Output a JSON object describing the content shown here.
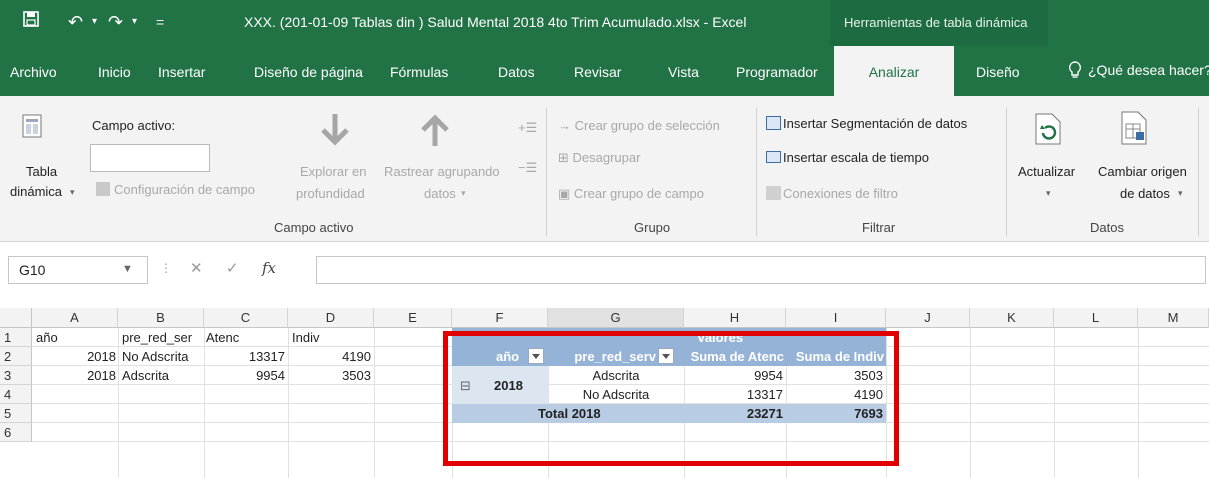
{
  "titlebar": {
    "save_icon": "save-icon",
    "title": "XXX. (201-01-09 Tablas din ) Salud Mental 2018 4to Trim Acumulado.xlsx  -  Excel",
    "context_tools": "Herramientas de tabla dinámica",
    "accent": "#217346"
  },
  "tabs": {
    "archivo": "Archivo",
    "inicio": "Inicio",
    "insertar": "Insertar",
    "diseno_pagina": "Diseño de página",
    "formulas": "Fórmulas",
    "datos": "Datos",
    "revisar": "Revisar",
    "vista": "Vista",
    "programador": "Programador",
    "analizar": "Analizar",
    "diseno": "Diseño",
    "help": "¿Qué desea hacer?"
  },
  "ribbon": {
    "tabla_1": "Tabla",
    "tabla_2": "dinámica",
    "campo_activo_label": "Campo activo:",
    "configuracion_campo": "Configuración de campo",
    "explorar_1": "Explorar en",
    "explorar_2": "profundidad",
    "rastrear_1": "Rastrear agrupando",
    "rastrear_2": "datos",
    "group_campo_activo": "Campo activo",
    "crear_grupo_seleccion": "Crear grupo de selección",
    "desagrupar": "Desagrupar",
    "crear_grupo_campo": "Crear grupo de campo",
    "group_grupo": "Grupo",
    "insertar_segmentacion": "Insertar Segmentación de datos",
    "insertar_escala": "Insertar escala de tiempo",
    "conexiones_filtro": "Conexiones de filtro",
    "group_filtrar": "Filtrar",
    "actualizar": "Actualizar",
    "cambiar_origen_1": "Cambiar origen",
    "cambiar_origen_2": "de datos",
    "group_datos": "Datos"
  },
  "formula_bar": {
    "name_box": "G10",
    "fx": "fx",
    "formula_value": ""
  },
  "columns": [
    "A",
    "B",
    "C",
    "D",
    "E",
    "F",
    "G",
    "H",
    "I",
    "J",
    "K",
    "L",
    "M"
  ],
  "rows": [
    "1",
    "2",
    "3",
    "4",
    "5",
    "6"
  ],
  "source_table": {
    "headers": [
      "año",
      "pre_red_ser",
      "Atenc",
      "Indiv"
    ],
    "rows": [
      {
        "anio": "2018",
        "red": "No Adscrita",
        "atenc": "13317",
        "indiv": "4190"
      },
      {
        "anio": "2018",
        "red": "Adscrita",
        "atenc": "9954",
        "indiv": "3503"
      }
    ]
  },
  "pivot": {
    "valores": "Valores",
    "row_field_1": "año",
    "row_field_2": "pre_red_serv",
    "value_1": "Suma de Atenc",
    "value_2": "Suma de Indiv",
    "collapse": "⊟",
    "year": "2018",
    "items": [
      {
        "name": "Adscrita",
        "atenc": "9954",
        "indiv": "3503"
      },
      {
        "name": "No Adscrita",
        "atenc": "13317",
        "indiv": "4190"
      }
    ],
    "total_label": "Total 2018",
    "total_atenc": "23271",
    "total_indiv": "7693",
    "header_color": "#95b3d7",
    "highlight_color": "#e00000"
  }
}
